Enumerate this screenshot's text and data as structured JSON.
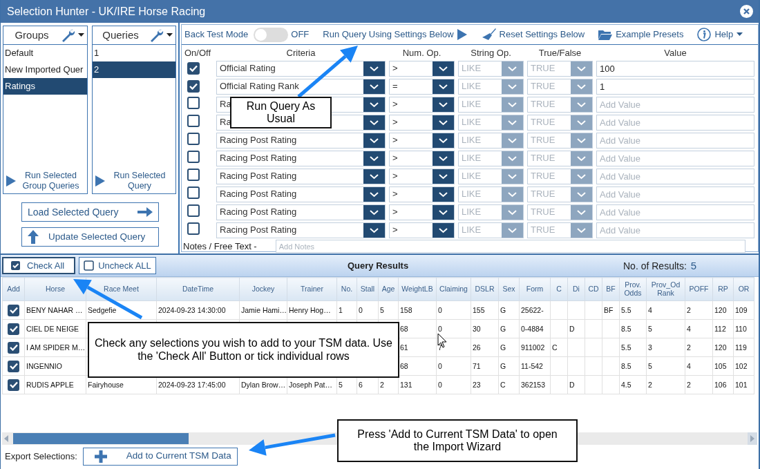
{
  "window": {
    "title": "Selection Hunter - UK/IRE Horse Racing"
  },
  "groups": {
    "title": "Groups",
    "items": [
      {
        "label": "Default",
        "selected": false
      },
      {
        "label": "New Imported Quer",
        "selected": false
      },
      {
        "label": "Ratings",
        "selected": true
      }
    ],
    "run_button": "Run Selected Group Queries"
  },
  "queries": {
    "title": "Queries",
    "items": [
      {
        "label": "1",
        "selected": false
      },
      {
        "label": "2",
        "selected": true
      }
    ],
    "run_button": "Run Selected Query"
  },
  "load_button": "Load Selected Query",
  "update_button": "Update Selected Query",
  "toolbar": {
    "back_test_label": "Back Test Mode",
    "back_test_on": false,
    "back_test_state": "OFF",
    "run_query": "Run Query Using Settings Below",
    "reset": "Reset Settings Below",
    "presets": "Example Presets",
    "help": "Help"
  },
  "criteria_columns": [
    "On/Off",
    "Criteria",
    "Num. Op.",
    "String Op.",
    "True/False",
    "Value"
  ],
  "criteria": [
    {
      "checked": true,
      "criteria": "Official Rating",
      "num_op": ">",
      "string_op": "LIKE",
      "string_op_disabled": true,
      "true_false": "TRUE",
      "true_false_disabled": true,
      "value": "100"
    },
    {
      "checked": true,
      "criteria": "Official Rating Rank",
      "num_op": "=",
      "string_op": "LIKE",
      "string_op_disabled": true,
      "true_false": "TRUE",
      "true_false_disabled": true,
      "value": "1"
    },
    {
      "checked": false,
      "criteria": "Ra",
      "num_op": ">",
      "string_op": "LIKE",
      "string_op_disabled": true,
      "true_false": "TRUE",
      "true_false_disabled": true,
      "placeholder": "Add Value"
    },
    {
      "checked": false,
      "criteria": "Ra",
      "num_op": ">",
      "string_op": "LIKE",
      "string_op_disabled": true,
      "true_false": "TRUE",
      "true_false_disabled": true,
      "placeholder": "Add Value"
    },
    {
      "checked": false,
      "criteria": "Racing Post Rating",
      "num_op": ">",
      "string_op": "LIKE",
      "string_op_disabled": true,
      "true_false": "TRUE",
      "true_false_disabled": true,
      "placeholder": "Add Value"
    },
    {
      "checked": false,
      "criteria": "Racing Post Rating",
      "num_op": ">",
      "string_op": "LIKE",
      "string_op_disabled": true,
      "true_false": "TRUE",
      "true_false_disabled": true,
      "placeholder": "Add Value"
    },
    {
      "checked": false,
      "criteria": "Racing Post Rating",
      "num_op": ">",
      "string_op": "LIKE",
      "string_op_disabled": true,
      "true_false": "TRUE",
      "true_false_disabled": true,
      "placeholder": "Add Value"
    },
    {
      "checked": false,
      "criteria": "Racing Post Rating",
      "num_op": ">",
      "string_op": "LIKE",
      "string_op_disabled": true,
      "true_false": "TRUE",
      "true_false_disabled": true,
      "placeholder": "Add Value"
    },
    {
      "checked": false,
      "criteria": "Racing Post Rating",
      "num_op": ">",
      "string_op": "LIKE",
      "string_op_disabled": true,
      "true_false": "TRUE",
      "true_false_disabled": true,
      "placeholder": "Add Value"
    },
    {
      "checked": false,
      "criteria": "Racing Post Rating",
      "num_op": ">",
      "string_op": "LIKE",
      "string_op_disabled": true,
      "true_false": "TRUE",
      "true_false_disabled": true,
      "placeholder": "Add Value"
    }
  ],
  "notes": {
    "label": "Notes / Free Text -",
    "placeholder": "Add Notes"
  },
  "results": {
    "check_all": "Check All",
    "uncheck_all": "Uncheck ALL",
    "title": "Query Results",
    "count_label": "No. of Results:",
    "count": "5",
    "columns": [
      "Add",
      "Horse",
      "Race Meet",
      "DateTime",
      "Jockey",
      "Trainer",
      "No.",
      "Stall",
      "Age",
      "WeightLB",
      "Claiming",
      "DSLR",
      "Sex",
      "Form",
      "C",
      "Di",
      "CD",
      "BF",
      "Prov. Odds",
      "Prov_Od Rank",
      "POFF",
      "RP",
      "OR"
    ],
    "rows": [
      {
        "checked": true,
        "cells": [
          "",
          "BENY NAHAR …",
          "Sedgefie",
          "2024-09-23 14:30:00",
          "Jamie Hami…",
          "Henry Hog…",
          "1",
          "0",
          "5",
          "158",
          "0",
          "155",
          "G",
          "25622-",
          null,
          null,
          null,
          "BF",
          "5.5",
          "4",
          "2",
          "120",
          "109"
        ]
      },
      {
        "checked": true,
        "cells": [
          "",
          "CIEL DE NEIGE",
          null,
          null,
          null,
          null,
          null,
          null,
          null,
          "68",
          "0",
          "30",
          "G",
          "0-4884",
          null,
          "D",
          null,
          null,
          "8.5",
          "5",
          "4",
          "112",
          "110"
        ]
      },
      {
        "checked": true,
        "cells": [
          "",
          "I AM SPIDER M…",
          null,
          null,
          null,
          null,
          null,
          null,
          null,
          "61",
          "7",
          "26",
          "G",
          "911002",
          "C",
          null,
          null,
          null,
          "5.5",
          "3",
          "2",
          "120",
          "119"
        ]
      },
      {
        "checked": true,
        "cells": [
          "",
          "INGENNIO",
          null,
          null,
          null,
          null,
          null,
          null,
          null,
          "68",
          "0",
          "71",
          "G",
          "11-542",
          null,
          null,
          null,
          null,
          "8.5",
          "5",
          "4",
          "105",
          "102"
        ]
      },
      {
        "checked": true,
        "cells": [
          "",
          "RUDIS APPLE",
          "Fairyhouse",
          "2024-09-23 17:45:00",
          "Dylan Brow…",
          "Joseph Pat…",
          "5",
          "6",
          "2",
          "131",
          "0",
          "23",
          "C",
          "362153",
          null,
          "D",
          null,
          null,
          "4.5",
          "2",
          "2",
          "106",
          "101"
        ]
      }
    ]
  },
  "export": {
    "label": "Export Selections:",
    "button": "Add to Current TSM Data"
  },
  "callouts": [
    {
      "text": "Run Query As Usual"
    },
    {
      "text": "Check any selections you wish to add to your TSM data. Use the 'Check All' Button or tick individual rows"
    },
    {
      "text": "Press 'Add to Current TSM Data' to open the Import Wizard"
    }
  ]
}
